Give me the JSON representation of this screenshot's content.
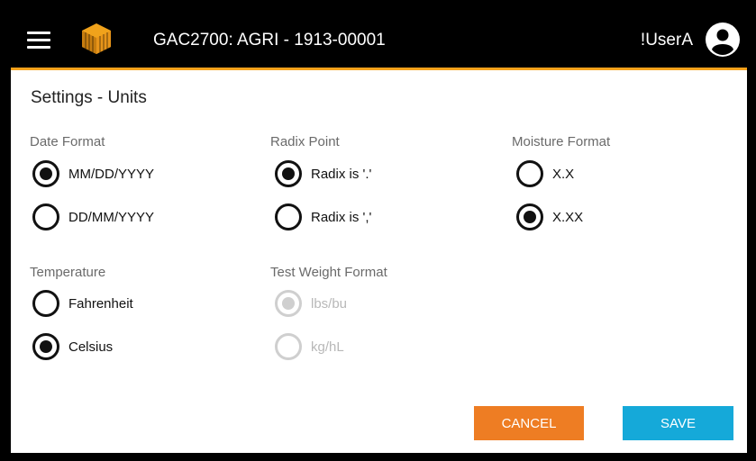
{
  "header": {
    "title": "GAC2700: AGRI - 1913-00001",
    "user": "!UserA",
    "accent_color": "#f7a21b",
    "menu_icon": "hamburger-menu-icon",
    "logo_icon": "cube-logo-icon",
    "avatar_icon": "user-account-icon"
  },
  "page": {
    "title": "Settings - Units"
  },
  "groups": {
    "date_format": {
      "label": "Date Format",
      "options": [
        {
          "label": "MM/DD/YYYY",
          "checked": true
        },
        {
          "label": "DD/MM/YYYY",
          "checked": false
        }
      ]
    },
    "radix_point": {
      "label": "Radix Point",
      "options": [
        {
          "label": "Radix is '.'",
          "checked": true
        },
        {
          "label": "Radix is ','",
          "checked": false
        }
      ]
    },
    "moisture_format": {
      "label": "Moisture Format",
      "options": [
        {
          "label": "X.X",
          "checked": false
        },
        {
          "label": "X.XX",
          "checked": true
        }
      ]
    },
    "temperature": {
      "label": "Temperature",
      "options": [
        {
          "label": "Fahrenheit",
          "checked": false
        },
        {
          "label": "Celsius",
          "checked": true
        }
      ]
    },
    "test_weight_format": {
      "label": "Test Weight Format",
      "disabled": true,
      "options": [
        {
          "label": "lbs/bu",
          "checked": true
        },
        {
          "label": "kg/hL",
          "checked": false
        }
      ]
    }
  },
  "buttons": {
    "cancel": "CANCEL",
    "save": "SAVE",
    "cancel_color": "#ee7d23",
    "save_color": "#15a9d9"
  }
}
